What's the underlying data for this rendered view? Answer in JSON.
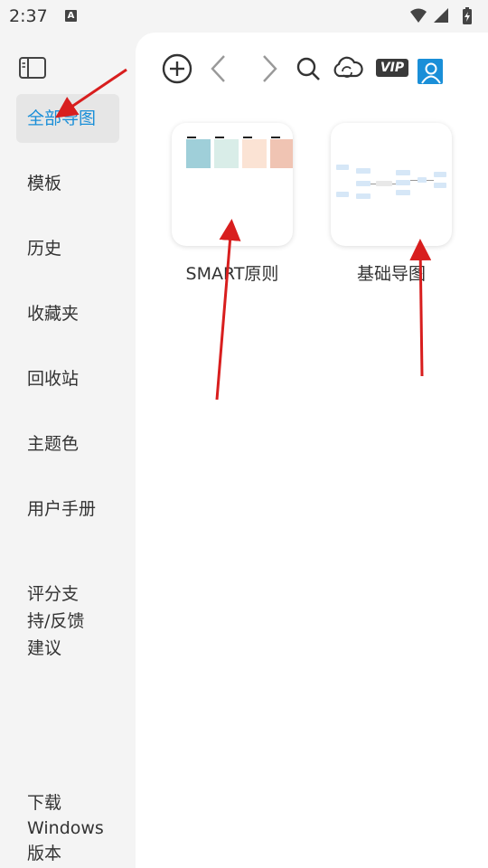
{
  "status_bar": {
    "time": "2:37",
    "notification_badge": "A"
  },
  "sidebar": {
    "items": [
      {
        "label": "全部导图",
        "active": true
      },
      {
        "label": "模板"
      },
      {
        "label": "历史"
      },
      {
        "label": "收藏夹"
      },
      {
        "label": "回收站"
      },
      {
        "label": "主题色"
      },
      {
        "label": "用户手册"
      },
      {
        "label": "评分支\n持/反馈\n建议"
      },
      {
        "label": "下载\nWindows\n版本"
      }
    ]
  },
  "toolbar": {
    "vip_label": "VIP",
    "icons": [
      "add-icon",
      "back-icon",
      "forward-icon",
      "search-icon",
      "cloud-sync-icon",
      "vip-icon",
      "user-icon"
    ]
  },
  "documents": [
    {
      "title": "SMART原则"
    },
    {
      "title": "基础导图"
    }
  ],
  "colors": {
    "accent": "#1a8fd8",
    "annotation_arrow": "#d81e1e",
    "swatches": [
      "#9fcfd9",
      "#d9ede8",
      "#fbe3d4",
      "#f0c4b3"
    ]
  }
}
